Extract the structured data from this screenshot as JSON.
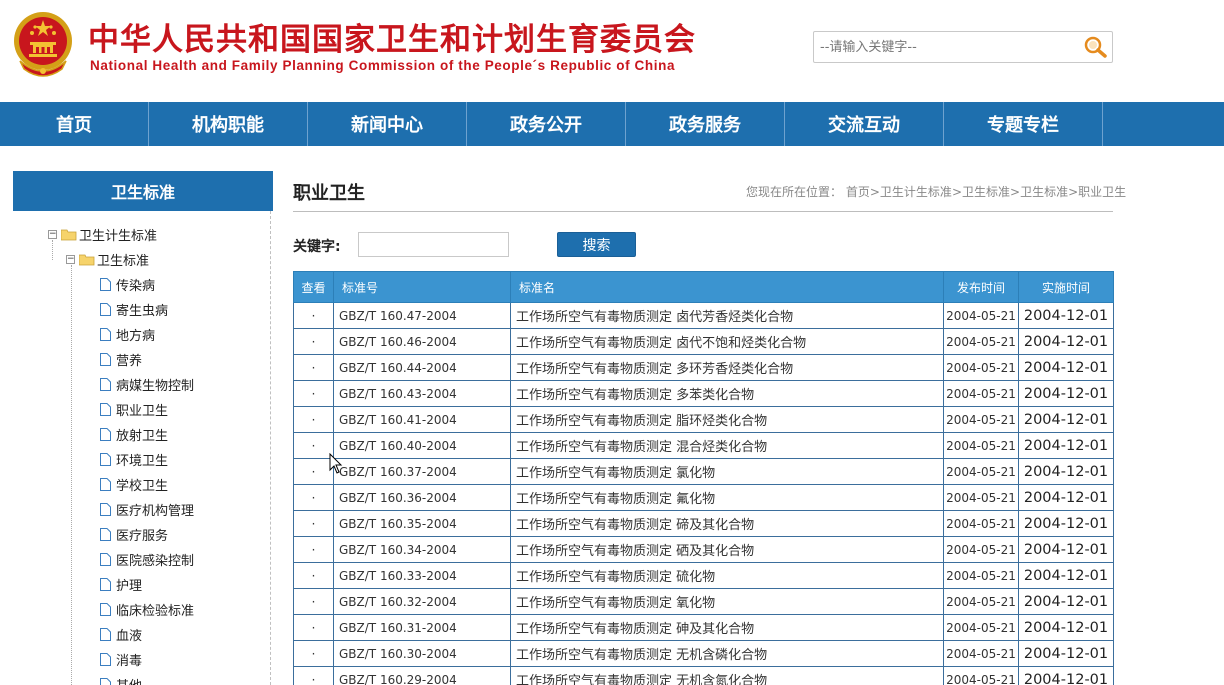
{
  "header": {
    "title_cn": "中华人民共和国国家卫生和计划生育委员会",
    "title_en": "National Health and Family Planning Commission of the People´s Republic of China",
    "search_placeholder": "--请输入关键字--",
    "brand_color": "#c8161d"
  },
  "nav": {
    "color": "#1e6fae",
    "items": [
      "首页",
      "机构职能",
      "新闻中心",
      "政务公开",
      "政务服务",
      "交流互动",
      "专题专栏"
    ]
  },
  "sidebar": {
    "title": "卫生标准",
    "root": "卫生计生标准",
    "branch": "卫生标准",
    "leaves": [
      "传染病",
      "寄生虫病",
      "地方病",
      "营养",
      "病媒生物控制",
      "职业卫生",
      "放射卫生",
      "环境卫生",
      "学校卫生",
      "医疗机构管理",
      "医疗服务",
      "医院感染控制",
      "护理",
      "临床检验标准",
      "血液",
      "消毒",
      "其他"
    ]
  },
  "content": {
    "title": "职业卫生",
    "breadcrumb": {
      "prefix": "您现在所在位置：",
      "items": [
        "首页",
        "卫生计生标准",
        "卫生标准",
        "卫生标准",
        "职业卫生"
      ],
      "separator": ">"
    },
    "keyword_label": "关键字:",
    "search_button": "搜索"
  },
  "table": {
    "headers": [
      "查看",
      "标准号",
      "标准名",
      "发布时间",
      "实施时间"
    ],
    "rows": [
      {
        "check": "·",
        "code": "GBZ/T 160.47-2004",
        "name": "工作场所空气有毒物质测定 卤代芳香烃类化合物",
        "pub": "2004-05-21",
        "imp": "2004-12-01"
      },
      {
        "check": "·",
        "code": "GBZ/T 160.46-2004",
        "name": "工作场所空气有毒物质测定 卤代不饱和烃类化合物",
        "pub": "2004-05-21",
        "imp": "2004-12-01"
      },
      {
        "check": "·",
        "code": "GBZ/T 160.44-2004",
        "name": "工作场所空气有毒物质测定 多环芳香烃类化合物",
        "pub": "2004-05-21",
        "imp": "2004-12-01"
      },
      {
        "check": "·",
        "code": "GBZ/T 160.43-2004",
        "name": "工作场所空气有毒物质测定 多苯类化合物",
        "pub": "2004-05-21",
        "imp": "2004-12-01"
      },
      {
        "check": "·",
        "code": "GBZ/T 160.41-2004",
        "name": "工作场所空气有毒物质测定 脂环烃类化合物",
        "pub": "2004-05-21",
        "imp": "2004-12-01"
      },
      {
        "check": "·",
        "code": "GBZ/T 160.40-2004",
        "name": "工作场所空气有毒物质测定 混合烃类化合物",
        "pub": "2004-05-21",
        "imp": "2004-12-01"
      },
      {
        "check": "·",
        "code": "GBZ/T 160.37-2004",
        "name": "工作场所空气有毒物质测定 氯化物",
        "pub": "2004-05-21",
        "imp": "2004-12-01"
      },
      {
        "check": "·",
        "code": "GBZ/T 160.36-2004",
        "name": "工作场所空气有毒物质测定 氟化物",
        "pub": "2004-05-21",
        "imp": "2004-12-01"
      },
      {
        "check": "·",
        "code": "GBZ/T 160.35-2004",
        "name": "工作场所空气有毒物质测定 碲及其化合物",
        "pub": "2004-05-21",
        "imp": "2004-12-01"
      },
      {
        "check": "·",
        "code": "GBZ/T 160.34-2004",
        "name": "工作场所空气有毒物质测定 硒及其化合物",
        "pub": "2004-05-21",
        "imp": "2004-12-01"
      },
      {
        "check": "·",
        "code": "GBZ/T 160.33-2004",
        "name": "工作场所空气有毒物质测定 硫化物",
        "pub": "2004-05-21",
        "imp": "2004-12-01"
      },
      {
        "check": "·",
        "code": "GBZ/T 160.32-2004",
        "name": "工作场所空气有毒物质测定 氧化物",
        "pub": "2004-05-21",
        "imp": "2004-12-01"
      },
      {
        "check": "·",
        "code": "GBZ/T 160.31-2004",
        "name": "工作场所空气有毒物质测定 砷及其化合物",
        "pub": "2004-05-21",
        "imp": "2004-12-01"
      },
      {
        "check": "·",
        "code": "GBZ/T 160.30-2004",
        "name": "工作场所空气有毒物质测定 无机含磷化合物",
        "pub": "2004-05-21",
        "imp": "2004-12-01"
      },
      {
        "check": "·",
        "code": "GBZ/T 160.29-2004",
        "name": "工作场所空气有毒物质测定 无机含氮化合物",
        "pub": "2004-05-21",
        "imp": "2004-12-01"
      }
    ]
  }
}
